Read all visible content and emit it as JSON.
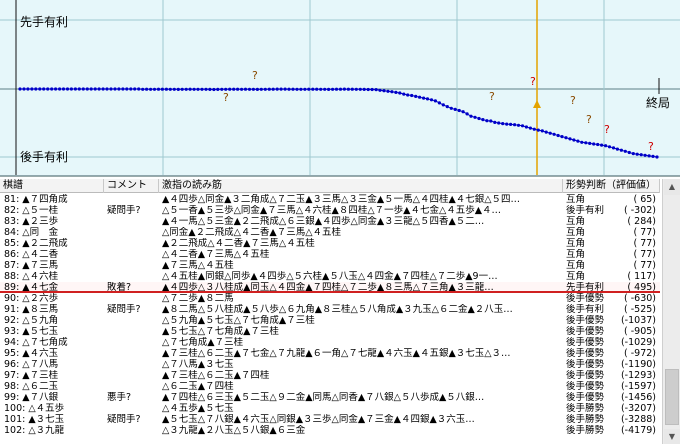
{
  "graph": {
    "label_top": "先手有利",
    "label_bottom": "後手有利",
    "label_end": "終局",
    "question": "?",
    "points": [
      0,
      0,
      0,
      0,
      0,
      0,
      0,
      0,
      0,
      0,
      0,
      0,
      0,
      0,
      0,
      0,
      0,
      0,
      0,
      0,
      0,
      0,
      0,
      0,
      0,
      0,
      0,
      0,
      0,
      0,
      0,
      -10,
      -8,
      -12,
      -10,
      -8,
      -6,
      -8,
      -10,
      -12,
      -14,
      -12,
      -10,
      -8,
      -10,
      -12,
      -12,
      -12,
      -14,
      -16,
      -14,
      -12,
      -10,
      -8,
      -6,
      -8,
      -10,
      -8,
      -10,
      -12,
      -14,
      -12,
      -10,
      -8,
      -6,
      -4,
      -2,
      -4,
      -6,
      -8,
      -10,
      -12,
      -10,
      -8,
      -6,
      -8,
      -10,
      -12,
      -14,
      -10,
      -8,
      -6,
      -4,
      -6,
      -8,
      -10,
      -12,
      -14,
      -16,
      -18,
      -20,
      -45,
      -60,
      -80,
      -95,
      -120,
      -140,
      -180,
      -210,
      -230,
      -260,
      -290,
      -320,
      -350,
      -380,
      -420,
      -490,
      -560,
      -620,
      -680,
      -720,
      -760,
      -800,
      -880,
      -960,
      -1000,
      -1040,
      -1080,
      -1120,
      -1130,
      -1180,
      -1200,
      -1220,
      -1240,
      -1250,
      -1260,
      -1280,
      -1300,
      -1340,
      -1380,
      -1420,
      -1450,
      -1480,
      -1520,
      -1560,
      -1600,
      -1640,
      -1680,
      -1720,
      -1760,
      -1800,
      -1840,
      -1880,
      -1900,
      -1920,
      -1940,
      -1960,
      -1980,
      -2000,
      -2040,
      -2080,
      -2120,
      -2160,
      -2200,
      -2240,
      -2280,
      -2300,
      -2320,
      -2340,
      -2360,
      -2380,
      -2400
    ]
  },
  "header": {
    "move": "棋譜",
    "comment": "コメント",
    "pv": "激指の読み筋",
    "judge": "形勢判断（評価値）"
  },
  "rows": [
    {
      "move": "81: ▲７四角成",
      "comment": "",
      "pv": "▲４四歩△同金▲３二角成△７二玉▲３三馬△３三金▲５一馬△４四桂▲４七銀△５四…",
      "judge": "互角",
      "val": "(   65)"
    },
    {
      "move": "82: △５一桂",
      "comment": "疑問手?",
      "pv": "△５一香▲５三歩△同金▲７三馬△４六桂▲８四桂△７一歩▲４七金△４五歩▲４…",
      "judge": "後手有利",
      "val": "( -302)"
    },
    {
      "move": "83: ▲２三歩",
      "comment": "",
      "pv": "▲４一馬△５三金▲２二飛成△６三銀▲４四歩△同金▲３三龍△５四香▲５二…",
      "judge": "互角",
      "val": "(  284)"
    },
    {
      "move": "84: △同　金",
      "comment": "",
      "pv": "△同金▲２二飛成△４二香▲７三馬△４五桂",
      "judge": "互角",
      "val": "(   77)"
    },
    {
      "move": "85: ▲２二飛成",
      "comment": "",
      "pv": "▲２二飛成△４二香▲７三馬△４五桂",
      "judge": "互角",
      "val": "(   77)"
    },
    {
      "move": "86: △４二香",
      "comment": "",
      "pv": "△４二香▲７三馬△４五桂",
      "judge": "互角",
      "val": "(   77)"
    },
    {
      "move": "87: ▲７三馬",
      "comment": "",
      "pv": "▲７三馬△４五桂",
      "judge": "互角",
      "val": "(   77)"
    },
    {
      "move": "88: △４六桂",
      "comment": "",
      "pv": "△４五桂▲同銀△同歩▲４四歩△５六桂▲５八玉△４四金▲７四桂△７二歩▲9一…",
      "judge": "互角",
      "val": "(  117)"
    },
    {
      "move": "89: ▲４七金",
      "comment": "敗着?",
      "pv": "▲４四歩△３八桂成▲同玉△４四金▲７四桂△７二歩▲８三馬△７三角▲３三龍…",
      "judge": "先手有利",
      "val": "(  495)"
    },
    {
      "move": "90: △２六歩",
      "comment": "",
      "pv": "△７二歩▲８二馬",
      "judge": "後手優勢",
      "val": "( -630)"
    },
    {
      "move": "91: ▲８三馬",
      "comment": "疑問手?",
      "pv": "▲８二馬△５八桂成▲５八歩△６九角▲８三桂△５八角成▲３九玉△６二金▲２八玉…",
      "judge": "後手有利",
      "val": "( -525)"
    },
    {
      "move": "92: △５九角",
      "comment": "",
      "pv": "△５九角▲５七玉△７七角成▲７三桂",
      "judge": "後手優勢",
      "val": "(-1037)"
    },
    {
      "move": "93: ▲５七玉",
      "comment": "",
      "pv": "▲５七玉△７七角成▲７三桂",
      "judge": "後手優勢",
      "val": "( -905)"
    },
    {
      "move": "94: △７七角成",
      "comment": "",
      "pv": "△７七角成▲７三桂",
      "judge": "後手優勢",
      "val": "(-1029)"
    },
    {
      "move": "95: ▲４六玉",
      "comment": "",
      "pv": "▲７三桂△６二玉▲７七金△７九龍▲６一角△７七龍▲４六玉▲４五銀▲３七玉△３…",
      "judge": "後手優勢",
      "val": "( -972)"
    },
    {
      "move": "96: △７八馬",
      "comment": "",
      "pv": "△７八馬▲３七玉",
      "judge": "後手優勢",
      "val": "(-1190)"
    },
    {
      "move": "97: ▲７三桂",
      "comment": "",
      "pv": "▲７三桂△６二玉▲７四桂",
      "judge": "後手優勢",
      "val": "(-1293)"
    },
    {
      "move": "98: △６二玉",
      "comment": "",
      "pv": "△６二玉▲７四桂",
      "judge": "後手優勢",
      "val": "(-1597)"
    },
    {
      "move": "99: ▲７八銀",
      "comment": "悪手?",
      "pv": "▲７四桂△６三玉▲５二玉△９二金▲同馬△同香▲７八銀△５八歩成▲５八銀…",
      "judge": "後手優勢",
      "val": "(-1456)"
    },
    {
      "move": "100: △４五歩",
      "comment": "",
      "pv": "△４五歩▲５七玉",
      "judge": "後手勝勢",
      "val": "(-3207)"
    },
    {
      "move": "101: ▲３七玉",
      "comment": "疑問手?",
      "pv": "▲５七玉△７八銀▲４六玉△同銀▲３三歩△同金▲７三金▲４四銀▲３六玉…",
      "judge": "後手勝勢",
      "val": "(-3288)"
    },
    {
      "move": "102: △３九龍",
      "comment": "",
      "pv": "△３九龍▲２八玉△５八銀▲６三金",
      "judge": "後手勝勢",
      "val": "(-4179)"
    }
  ]
}
